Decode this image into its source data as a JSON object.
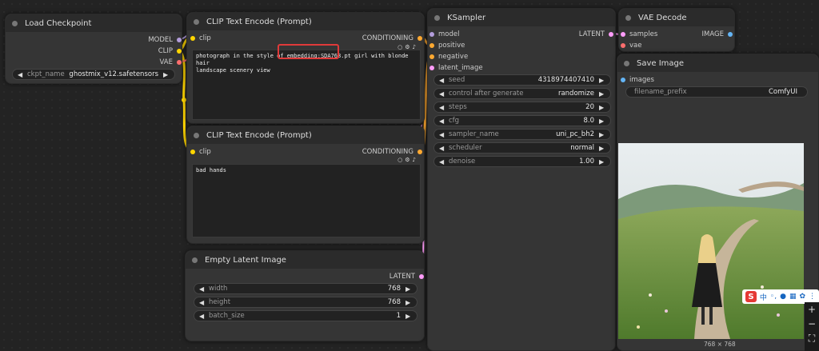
{
  "colors": {
    "model": "#b39ddb",
    "clip": "#ffd500",
    "vae": "#ff6e6e",
    "conditioning": "#ffa931",
    "latent": "#ff9cf9",
    "image": "#64b5f6",
    "highlight": "#e03a3a"
  },
  "load_checkpoint": {
    "title": "Load Checkpoint",
    "outputs": [
      "MODEL",
      "CLIP",
      "VAE"
    ],
    "ckpt_name": {
      "label": "ckpt_name",
      "value": "ghostmix_v12.safetensors"
    }
  },
  "clip_pos": {
    "title": "CLIP Text Encode (Prompt)",
    "input": "clip",
    "output": "CONDITIONING",
    "text_before": "photograph in the style of ",
    "text_embedding": "embedding:SDA768.pt",
    "text_after": " girl with blonde hair",
    "text_line2": "landscape scenery view"
  },
  "clip_neg": {
    "title": "CLIP Text Encode (Prompt)",
    "input": "clip",
    "output": "CONDITIONING",
    "text": "bad hands"
  },
  "empty_latent": {
    "title": "Empty Latent Image",
    "output": "LATENT",
    "widgets": [
      {
        "label": "width",
        "value": "768"
      },
      {
        "label": "height",
        "value": "768"
      },
      {
        "label": "batch_size",
        "value": "1"
      }
    ]
  },
  "ksampler": {
    "title": "KSampler",
    "inputs": [
      "model",
      "positive",
      "negative",
      "latent_image"
    ],
    "output": "LATENT",
    "widgets": [
      {
        "label": "seed",
        "value": "4318974407410"
      },
      {
        "label": "control after generate",
        "value": "randomize"
      },
      {
        "label": "steps",
        "value": "20"
      },
      {
        "label": "cfg",
        "value": "8.0"
      },
      {
        "label": "sampler_name",
        "value": "uni_pc_bh2"
      },
      {
        "label": "scheduler",
        "value": "normal"
      },
      {
        "label": "denoise",
        "value": "1.00"
      }
    ]
  },
  "vae_decode": {
    "title": "VAE Decode",
    "inputs": [
      "samples",
      "vae"
    ],
    "output": "IMAGE"
  },
  "save_image": {
    "title": "Save Image",
    "input": "images",
    "filename_prefix": {
      "label": "filename_prefix",
      "value": "ComfyUI"
    },
    "caption": "768 × 768"
  },
  "ime_bar": {
    "logo": "S",
    "lang": "中"
  },
  "zoom": {
    "plus": "+",
    "minus": "−",
    "fit": "⛶"
  }
}
